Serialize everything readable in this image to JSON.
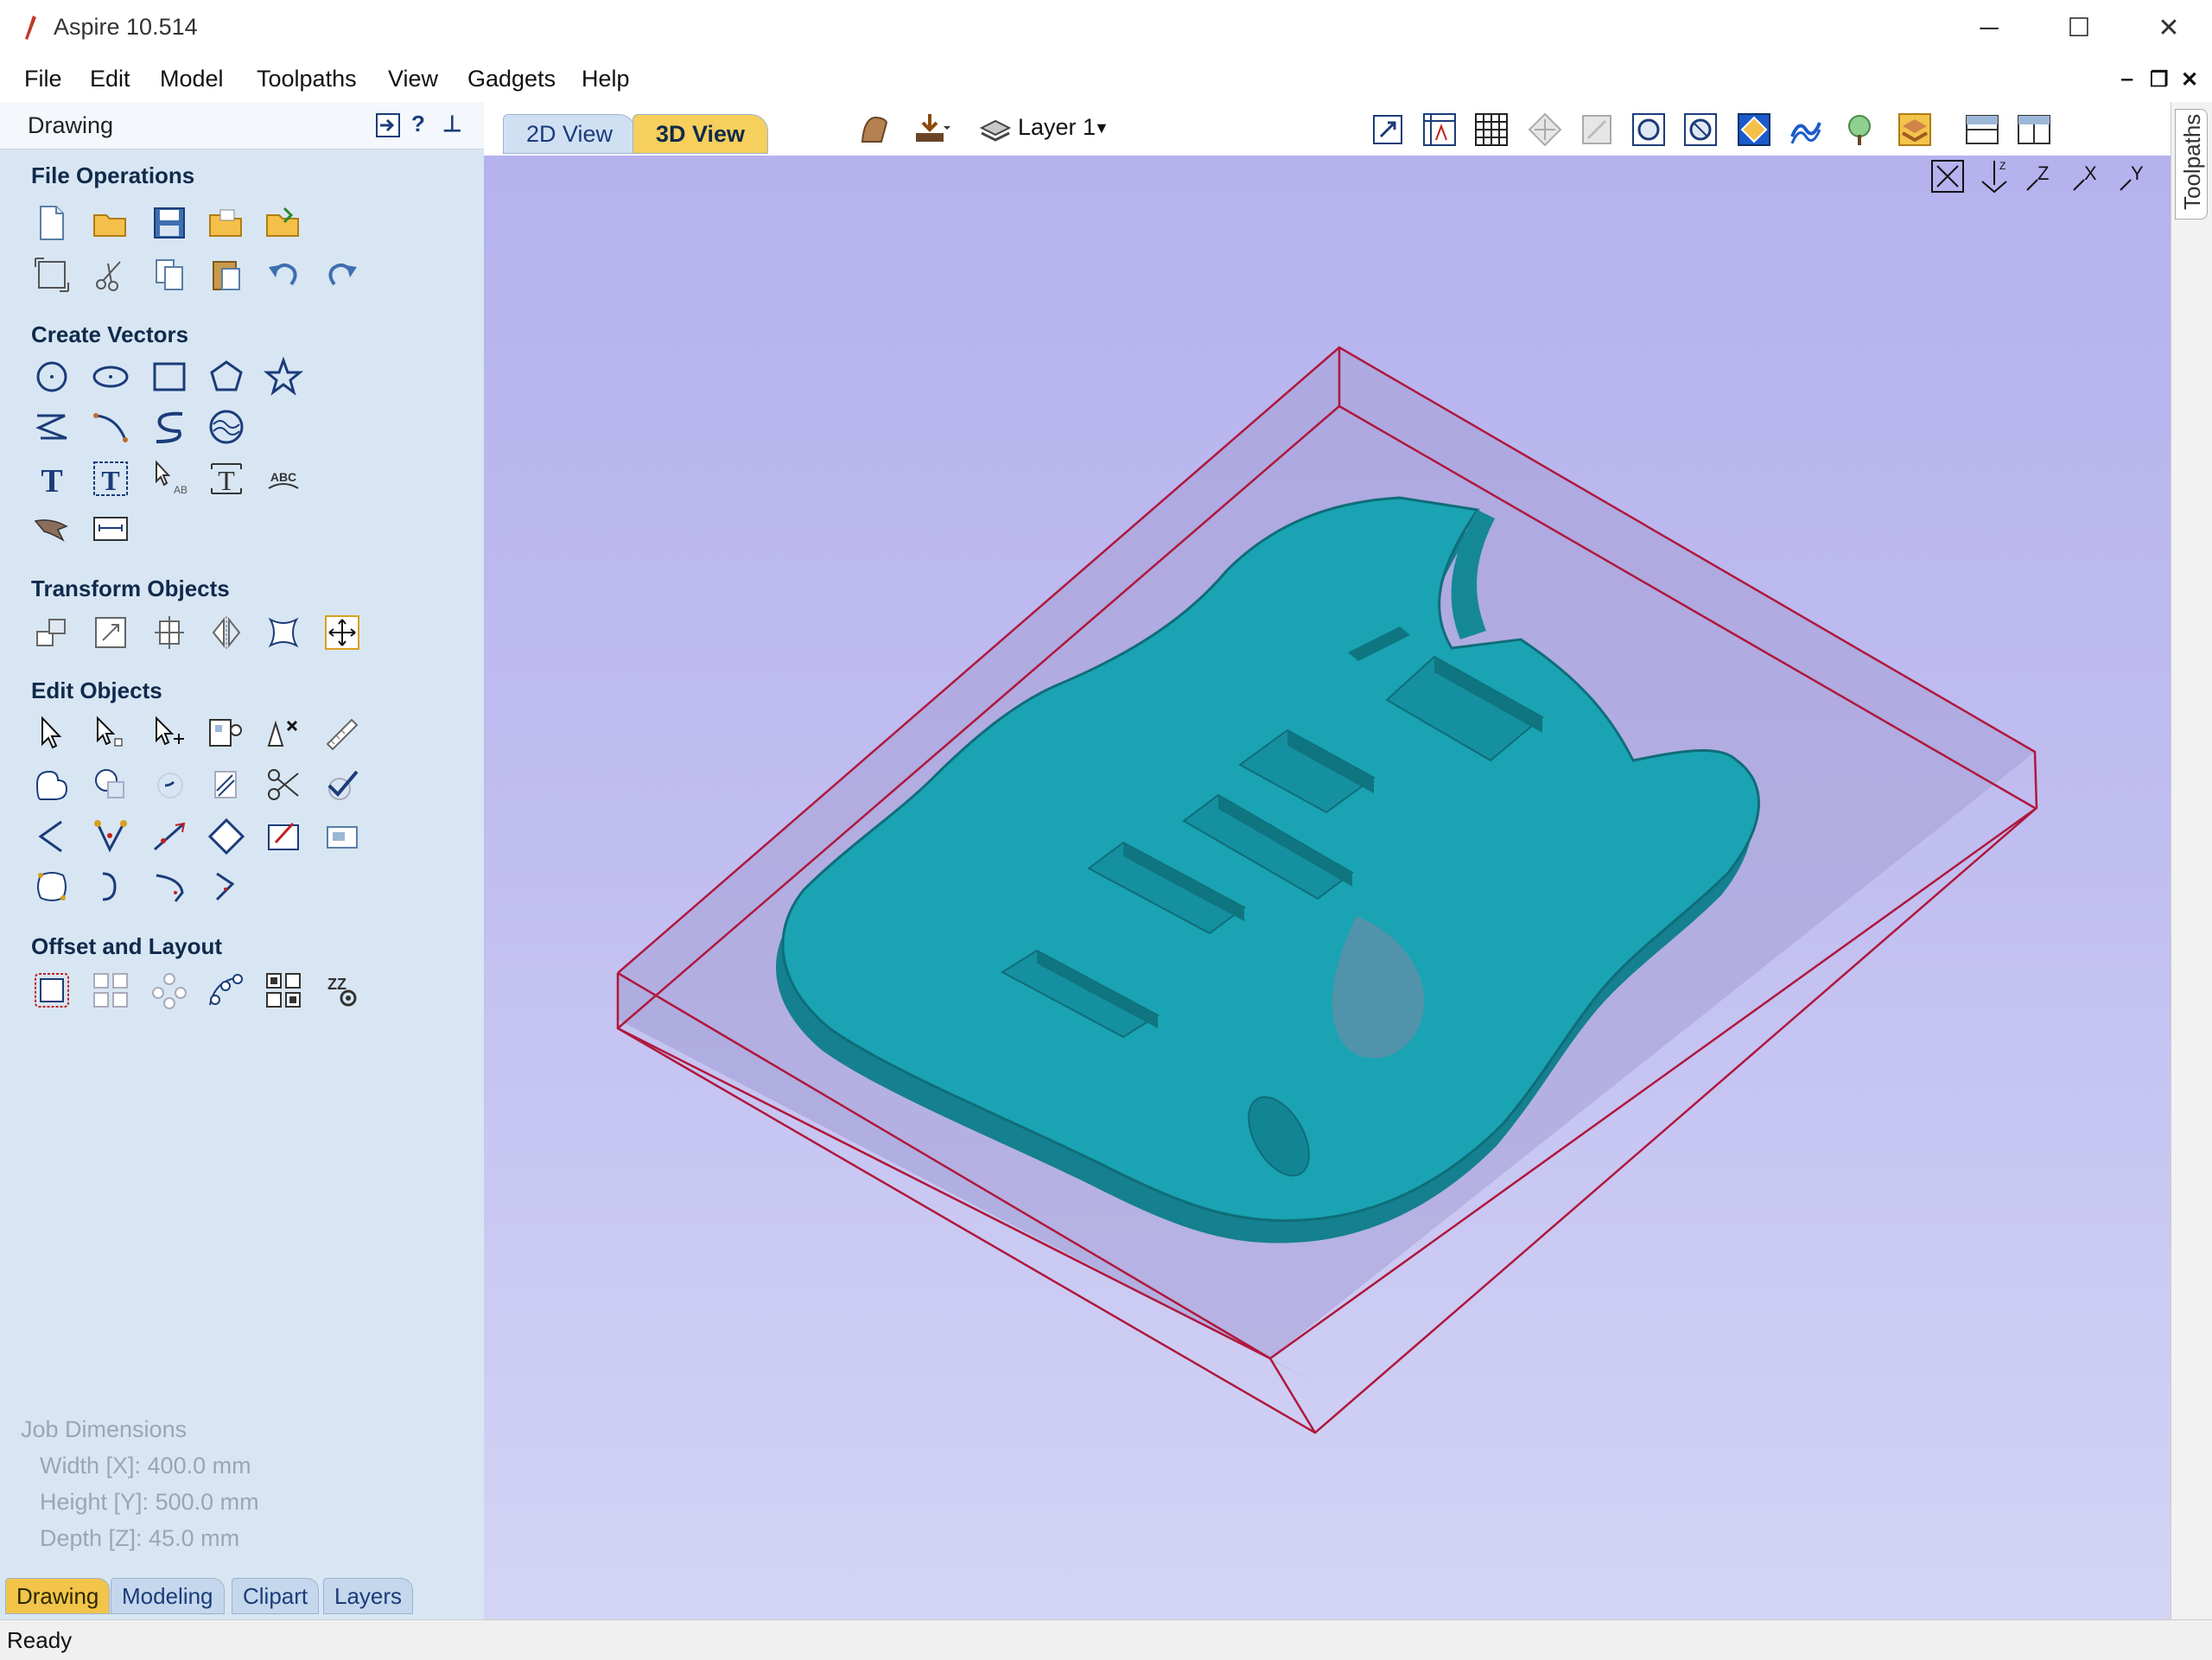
{
  "window": {
    "title": "Aspire 10.514",
    "minimize": "─",
    "maximize": "☐",
    "close": "✕"
  },
  "menu": [
    "File",
    "Edit",
    "Model",
    "Toolpaths",
    "View",
    "Gadgets",
    "Help"
  ],
  "mdi_controls": {
    "minimize": "‒",
    "restore": "❐",
    "close": "✕"
  },
  "panel": {
    "title": "Drawing",
    "help": "?",
    "pin": "⊥",
    "sections": {
      "file_operations": "File Operations",
      "create_vectors": "Create Vectors",
      "transform_objects": "Transform Objects",
      "edit_objects": "Edit Objects",
      "offset_layout": "Offset and Layout"
    },
    "job_dimensions": {
      "title": "Job Dimensions",
      "width": "Width  [X]: 400.0 mm",
      "height": "Height [Y]: 500.0 mm",
      "depth": "Depth  [Z]: 45.0 mm"
    },
    "bottom_tabs": [
      "Drawing",
      "Modeling",
      "Clipart",
      "Layers"
    ]
  },
  "view_tabs": {
    "tab_2d": "2D View",
    "tab_3d": "3D View"
  },
  "layer": {
    "label": "Layer 1"
  },
  "right_tab": "Toolpaths",
  "status": "Ready",
  "colors": {
    "guitar_body": "#1aa3b3",
    "material_box_edge": "#b0173c",
    "viewport_top": "#b5b2ee",
    "panel_bg": "#d8e6f3",
    "active_tab": "#f3c44a"
  }
}
